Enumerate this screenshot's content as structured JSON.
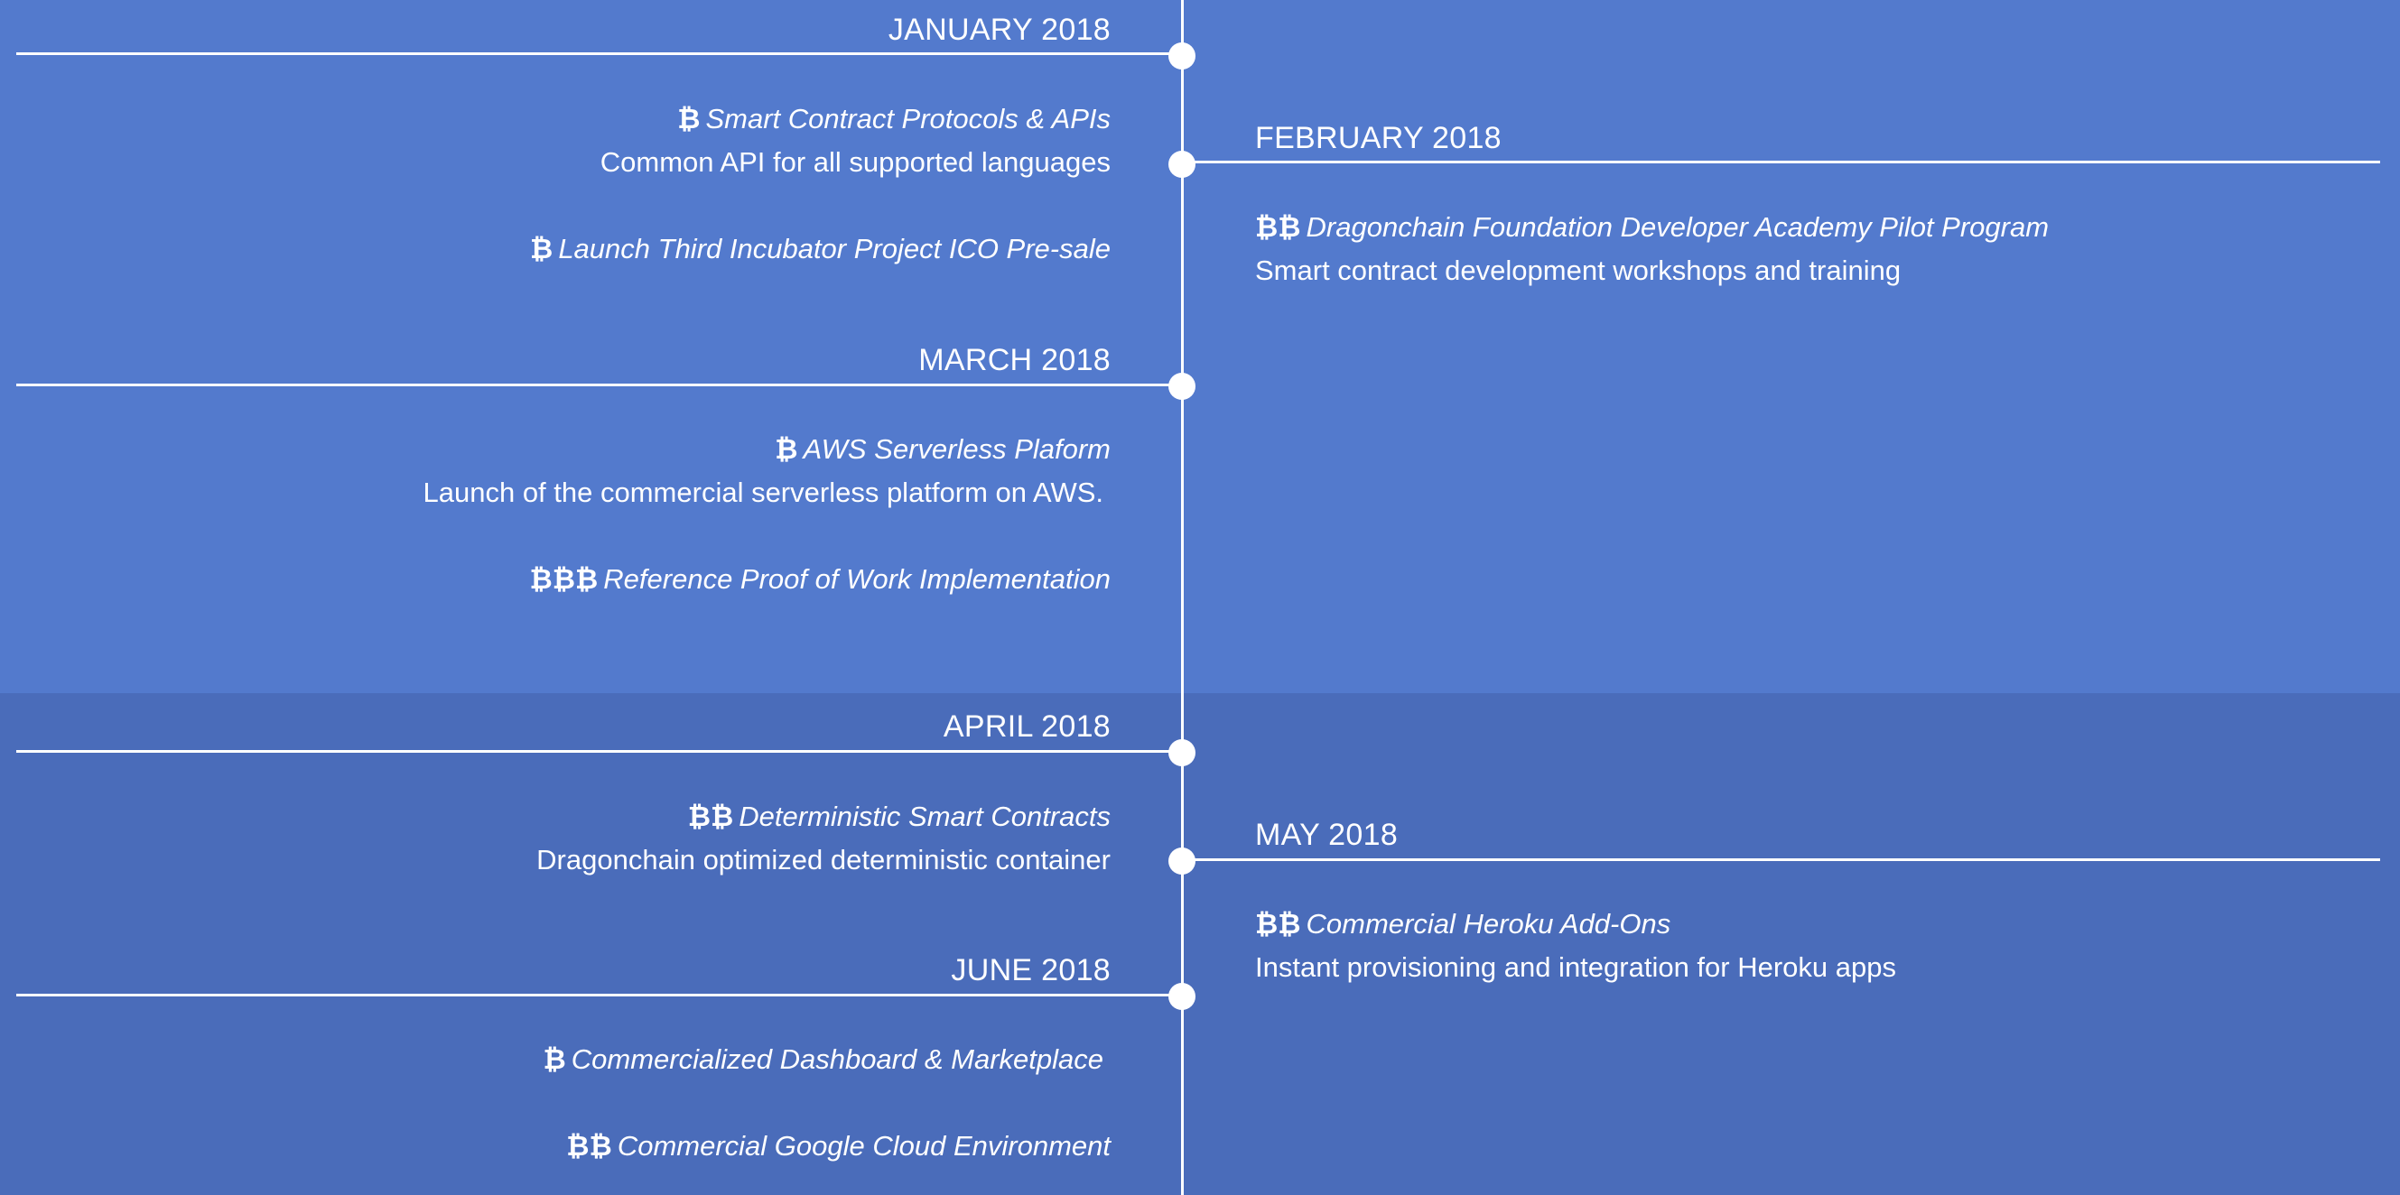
{
  "colors": {
    "band_top": "#537acd",
    "band_bottom": "#4a6cba",
    "line": "#ffffff",
    "text": "#ffffff"
  },
  "coin_glyph": "₿",
  "months": {
    "jan": "JANUARY 2018",
    "feb": "FEBRUARY 2018",
    "mar": "MARCH 2018",
    "apr": "APRIL 2018",
    "may": "MAY 2018",
    "jun": "JUNE 2018"
  },
  "items": {
    "jan_1": {
      "coins": "₿",
      "title": "Smart Contract Protocols & APIs",
      "desc": "Common API for all supported languages"
    },
    "jan_2": {
      "coins": "₿",
      "title": "Launch Third Incubator Project ICO Pre-sale"
    },
    "feb_1": {
      "coins": "₿₿",
      "title": "Dragonchain Foundation Developer Academy Pilot Program",
      "desc": "Smart contract development workshops and training"
    },
    "mar_1": {
      "coins": "₿",
      "title": "AWS Serverless Plaform",
      "desc": "Launch of the commercial serverless platform on AWS."
    },
    "mar_2": {
      "coins": "₿₿₿",
      "title": "Reference Proof of Work Implementation"
    },
    "apr_1": {
      "coins": "₿₿",
      "title": "Deterministic Smart Contracts",
      "desc": "Dragonchain optimized deterministic container"
    },
    "may_1": {
      "coins": "₿₿",
      "title": "Commercial Heroku Add-Ons",
      "desc": "Instant provisioning and integration for Heroku apps"
    },
    "jun_1": {
      "coins": "₿",
      "title": "Commercialized Dashboard & Marketplace"
    },
    "jun_2": {
      "coins": "₿₿",
      "title": "Commercial Google Cloud Environment"
    }
  }
}
